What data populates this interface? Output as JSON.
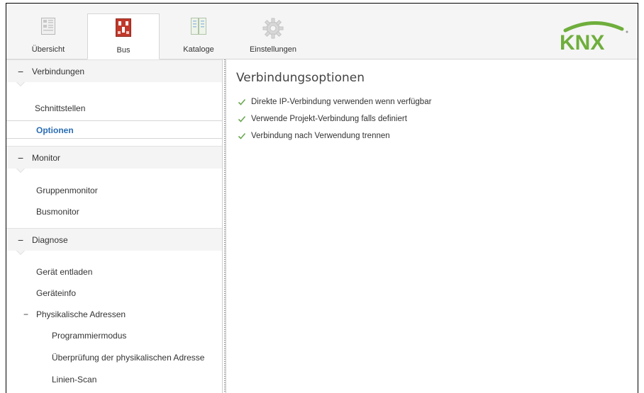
{
  "toolbar": {
    "tabs": [
      {
        "label": "Übersicht",
        "icon": "overview-icon",
        "active": false
      },
      {
        "label": "Bus",
        "icon": "bus-icon",
        "active": true
      },
      {
        "label": "Kataloge",
        "icon": "catalog-icon",
        "active": false
      },
      {
        "label": "Einstellungen",
        "icon": "settings-gear-icon",
        "active": false
      }
    ],
    "logo_text": "KNX"
  },
  "sidebar": {
    "sections": [
      {
        "label": "Verbindungen",
        "toggle": "−"
      },
      {
        "label": "Monitor",
        "toggle": "−"
      },
      {
        "label": "Diagnose",
        "toggle": "−"
      }
    ],
    "items": {
      "schnittstellen": "Schnittstellen",
      "optionen": "Optionen",
      "gruppenmonitor": "Gruppenmonitor",
      "busmonitor": "Busmonitor",
      "geraet_entladen": "Gerät entladen",
      "geraeteinfo": "Geräteinfo",
      "phys_adressen": "Physikalische Adressen",
      "phys_toggle": "−",
      "programmiermodus": "Programmiermodus",
      "ueberpruefung": "Überprüfung der physikalischen Adresse",
      "linien_scan": "Linien-Scan"
    }
  },
  "content": {
    "title": "Verbindungsoptionen",
    "options": [
      {
        "label": "Direkte IP-Verbindung verwenden wenn verfügbar",
        "checked": true
      },
      {
        "label": "Verwende Projekt-Verbindung falls definiert",
        "checked": true
      },
      {
        "label": "Verbindung nach Verwendung trennen",
        "checked": true
      }
    ]
  },
  "colors": {
    "accent": "#2a6db5",
    "check": "#6aa84f",
    "knx_green": "#6fae3c",
    "knx_blue": "#2b5ca6",
    "bus_red": "#c0392b"
  }
}
